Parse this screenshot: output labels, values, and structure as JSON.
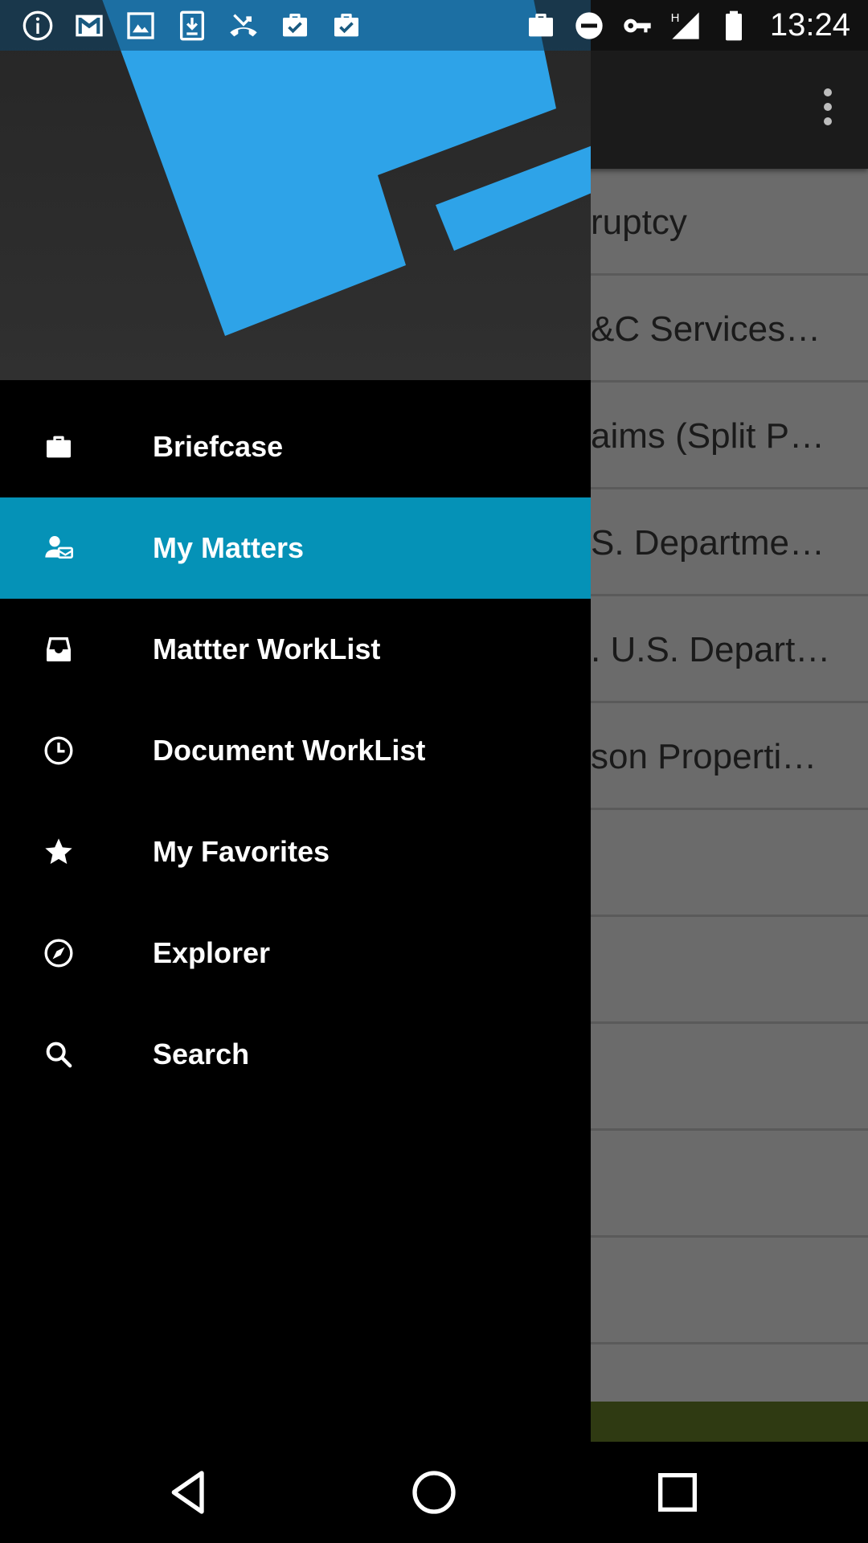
{
  "status_bar": {
    "time": "13:24",
    "left_icons": [
      "info-icon",
      "gmail-icon",
      "image-icon",
      "download-icon",
      "missed-call-icon",
      "briefcase-check-icon",
      "briefcase-check-icon"
    ],
    "right_icons": [
      "briefcase-icon",
      "do-not-disturb-icon",
      "vpn-key-icon",
      "signal-icon",
      "battery-icon"
    ],
    "network_label": "H"
  },
  "background_list": {
    "rows": [
      "ruptcy",
      "&C Services…",
      "aims (Split P…",
      "S. Departme…",
      ". U.S. Depart…",
      "son Properti…",
      "",
      "",
      "",
      "",
      ""
    ]
  },
  "drawer": {
    "menu_items": [
      {
        "label": "Briefcase",
        "icon": "briefcase-icon",
        "active": false
      },
      {
        "label": "My Matters",
        "icon": "person-matter-icon",
        "active": true
      },
      {
        "label": "Mattter WorkList",
        "icon": "inbox-icon",
        "active": false
      },
      {
        "label": "Document WorkList",
        "icon": "clock-icon",
        "active": false
      },
      {
        "label": "My Favorites",
        "icon": "star-icon",
        "active": false
      },
      {
        "label": "Explorer",
        "icon": "compass-icon",
        "active": false
      },
      {
        "label": "Search",
        "icon": "search-icon",
        "active": false
      }
    ]
  },
  "nav_bar": {
    "buttons": [
      "back-icon",
      "home-icon",
      "recents-icon"
    ]
  },
  "colors": {
    "active_item": "#0592b7",
    "logo_blue": "#2ea3e8",
    "drawer_bg": "#000000",
    "scrim": "#6b6b6b"
  }
}
